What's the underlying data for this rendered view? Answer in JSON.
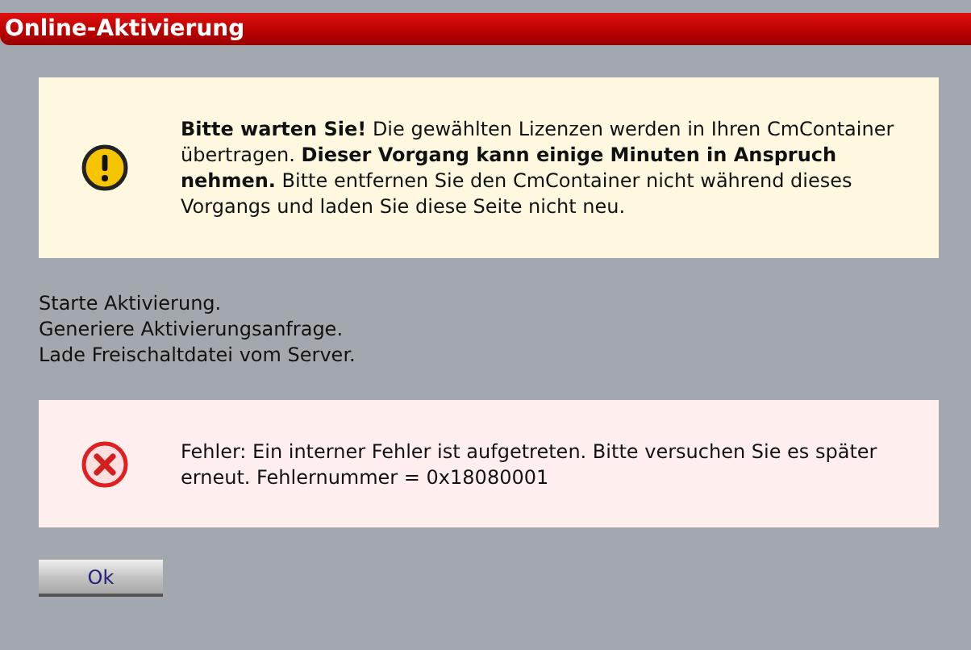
{
  "window": {
    "title": "Online-Aktivierung"
  },
  "notices": [
    {
      "kind": "warning",
      "text": "**Bitte warten Sie!** Die gewählten Lizenzen werden in Ihren CmContainer übertragen. **Dieser Vorgang kann einige Minuten in Anspruch nehmen.** Bitte entfernen Sie den CmContainer nicht während dieses Vorgangs und laden Sie diese Seite nicht neu."
    }
  ],
  "log": [
    "Starte Aktivierung.",
    "Generiere Aktivierungsanfrage.",
    "Lade Freischaltdatei vom Server."
  ],
  "errors": [
    {
      "kind": "error",
      "text": "Fehler: Ein interner Fehler ist aufgetreten. Bitte versuchen Sie es später erneut. Fehlernummer = 0x18080001"
    }
  ],
  "buttons": [
    "Ok"
  ]
}
